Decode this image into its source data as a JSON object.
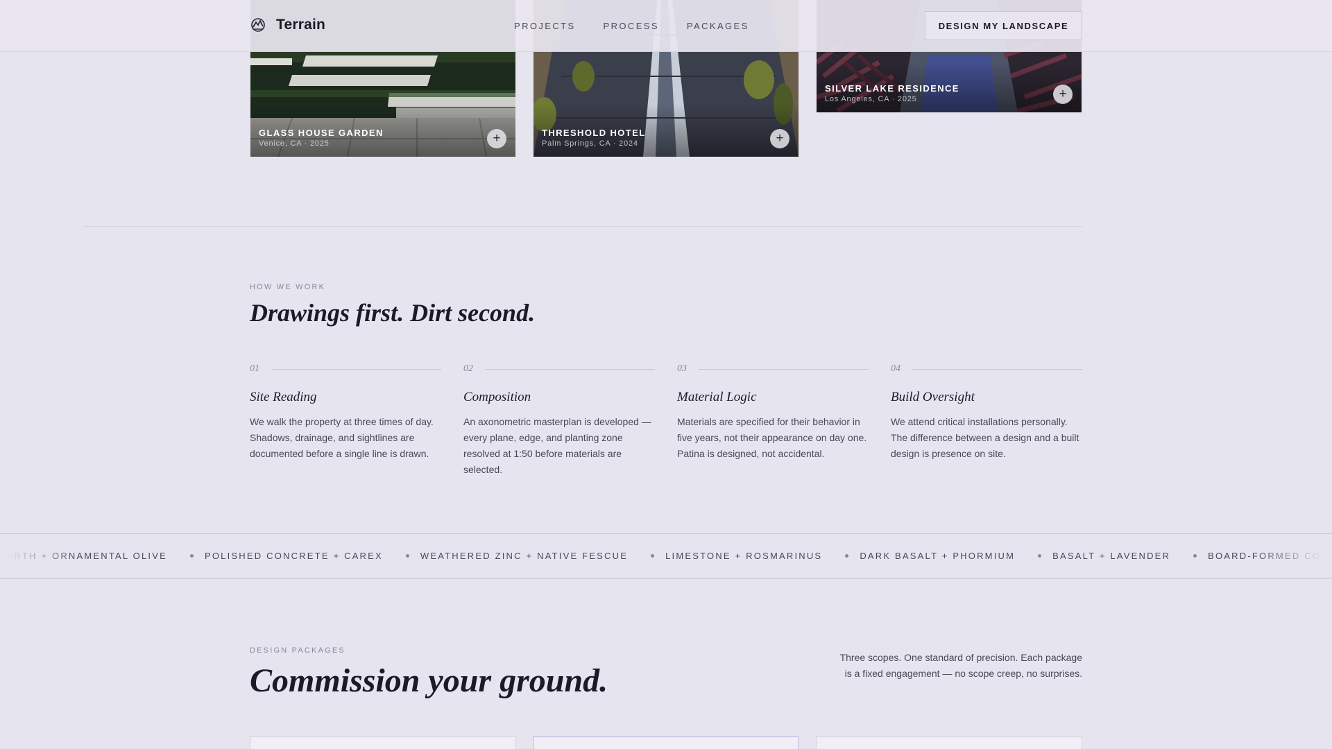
{
  "header": {
    "brand": "Terrain",
    "nav": [
      "PROJECTS",
      "PROCESS",
      "PACKAGES"
    ],
    "cta": "DESIGN MY LANDSCAPE"
  },
  "projects": [
    {
      "title": "GLASS HOUSE GARDEN",
      "meta": "Venice, CA · 2025"
    },
    {
      "title": "THRESHOLD HOTEL",
      "meta": "Palm Springs, CA · 2024"
    },
    {
      "title": "SILVER LAKE RESIDENCE",
      "meta": "Los Angeles, CA · 2025"
    }
  ],
  "process": {
    "eyebrow": "HOW WE WORK",
    "heading": "Drawings first. Dirt second.",
    "steps": [
      {
        "num": "01",
        "title": "Site Reading",
        "body": "We walk the property at three times of day. Shadows, drainage, and sightlines are documented before a single line is drawn."
      },
      {
        "num": "02",
        "title": "Composition",
        "body": "An axonometric masterplan is developed — every plane, edge, and planting zone resolved at 1:50 before materials are selected."
      },
      {
        "num": "03",
        "title": "Material Logic",
        "body": "Materials are specified for their behavior in five years, not their appearance on day one. Patina is designed, not accidental."
      },
      {
        "num": "04",
        "title": "Build Oversight",
        "body": "We attend critical installations personally. The difference between a design and a built design is presence on site."
      }
    ]
  },
  "materials": [
    "RAMMED EARTH + ORNAMENTAL OLIVE",
    "POLISHED CONCRETE + CAREX",
    "WEATHERED ZINC + NATIVE FESCUE",
    "LIMESTONE + ROSMARINUS",
    "DARK BASALT + PHORMIUM",
    "BASALT + LAVENDER",
    "BOARD-FORMED CONCRETE + AGAVE"
  ],
  "packages": {
    "eyebrow": "DESIGN PACKAGES",
    "heading": "Commission your ground.",
    "intro": "Three scopes. One standard of precision. Each package is a fixed engagement — no scope creep, no surprises."
  },
  "icons": {
    "logo": "terrain-logo-icon",
    "plus": "plus-icon"
  }
}
